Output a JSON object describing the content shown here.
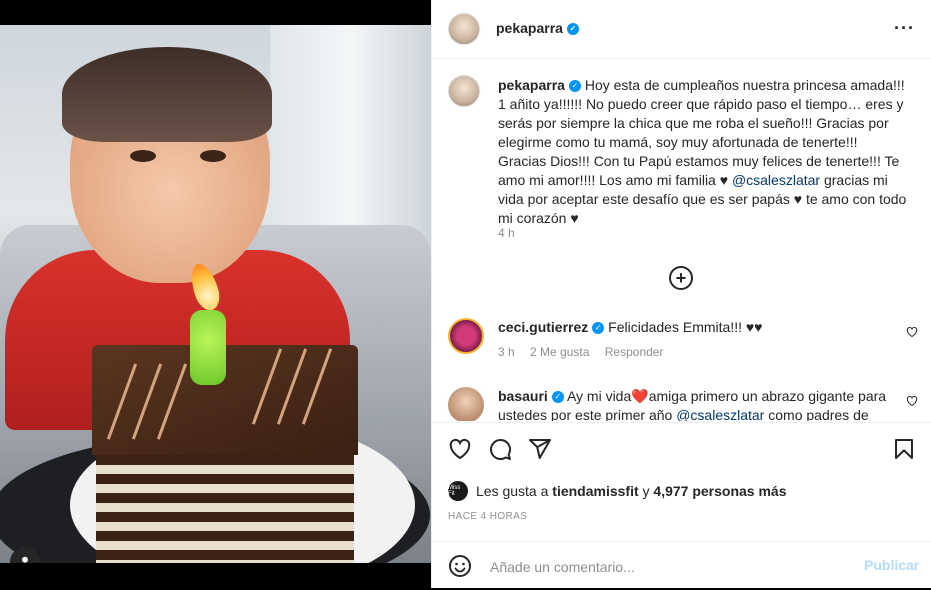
{
  "post": {
    "author": "pekaparra",
    "caption": "Hoy esta de cumpleaños nuestra princesa amada!!! 1 añito ya!!!!!! No puedo creer que rápido paso el tiempo… eres y serás por siempre la chica que me roba el sueño!!! Gracias por elegirme como tu mamá, soy muy afortunada de tenerte!!! Gracias Dios!!! Con tu Papú estamos muy felices de tenerte!!! Te amo mi amor!!!! Los amo mi familia ♥ ",
    "caption_mention": "@csaleszlatar",
    "caption_end": " gracias mi vida por aceptar este desafío que es ser papás ♥ te amo con todo mi corazón ♥",
    "caption_time": "4 h",
    "more_icon": "···"
  },
  "comments": [
    {
      "user": "ceci.gutierrez",
      "text": "Felicidades Emmita!!! ♥♥",
      "time": "3 h",
      "likes": "2 Me gusta",
      "reply": "Responder"
    },
    {
      "user": "basauri",
      "text": "Ay mi vida❤️amiga primero un abrazo gigante para ustedes por este primer año ",
      "mention": "@csaleszlatar",
      "text_end": " como padres de"
    }
  ],
  "likes": {
    "prefix": "Les gusta a ",
    "user": "tiendamissfit",
    "middle": " y ",
    "count": "4,977 personas más",
    "avatar_text": "Miss Fit"
  },
  "post_time": "HACE 4 HORAS",
  "comment_input": {
    "placeholder": "Añade un comentario...",
    "publish": "Publicar"
  },
  "colors": {
    "verified": "#0095f6",
    "publish_disabled": "#b3dbff",
    "heart_red": "#ed4956"
  },
  "icons": [
    "load-more-icon",
    "heart-icon",
    "comment-icon",
    "share-icon",
    "bookmark-icon",
    "emoji-icon",
    "user-tag-icon",
    "verified-icon"
  ]
}
